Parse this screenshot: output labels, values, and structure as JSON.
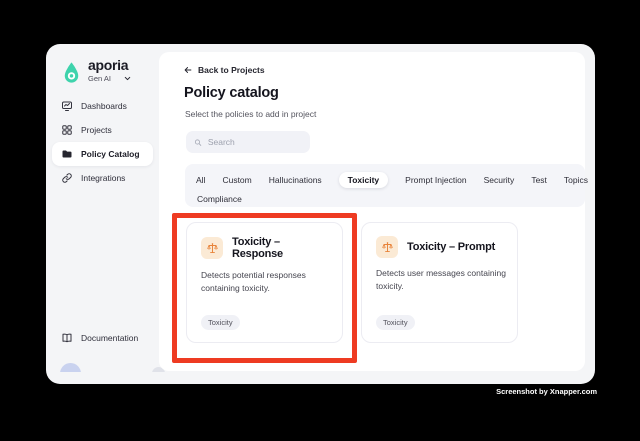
{
  "brand": {
    "name": "aporia",
    "workspace": "Gen AI"
  },
  "sidebar": {
    "items": [
      {
        "label": "Dashboards",
        "icon": "dashboard-icon"
      },
      {
        "label": "Projects",
        "icon": "projects-grid-icon"
      },
      {
        "label": "Policy Catalog",
        "icon": "folder-icon",
        "active": true
      },
      {
        "label": "Integrations",
        "icon": "link-icon"
      }
    ],
    "documentation_label": "Documentation"
  },
  "main": {
    "back_link_label": "Back to Projects",
    "title": "Policy catalog",
    "subtitle": "Select the policies to add in project",
    "search_placeholder": "Search",
    "tabs_row1": [
      "All",
      "Custom",
      "Hallucinations",
      "Toxicity",
      "Prompt Injection",
      "Security",
      "Test",
      "Topics"
    ],
    "tabs_row2": [
      "Compliance"
    ],
    "selected_tab": "Toxicity",
    "cards": [
      {
        "title": "Toxicity – Response",
        "description": "Detects potential responses containing toxicity.",
        "tag": "Toxicity",
        "icon": "scales-icon",
        "highlighted": true
      },
      {
        "title": "Toxicity – Prompt",
        "description": "Detects user messages containing toxicity.",
        "tag": "Toxicity",
        "icon": "scales-icon",
        "highlighted": false
      }
    ]
  },
  "watermark": "Screenshot by Xnapper.com",
  "colors": {
    "accent_teal": "#3ed3ac",
    "annotation_red": "#ee3b22",
    "icon_orange": "#e8833a",
    "icon_orange_bg": "#fbead5",
    "window_bg": "#f4f5f7",
    "panel_bg": "#ffffff"
  }
}
